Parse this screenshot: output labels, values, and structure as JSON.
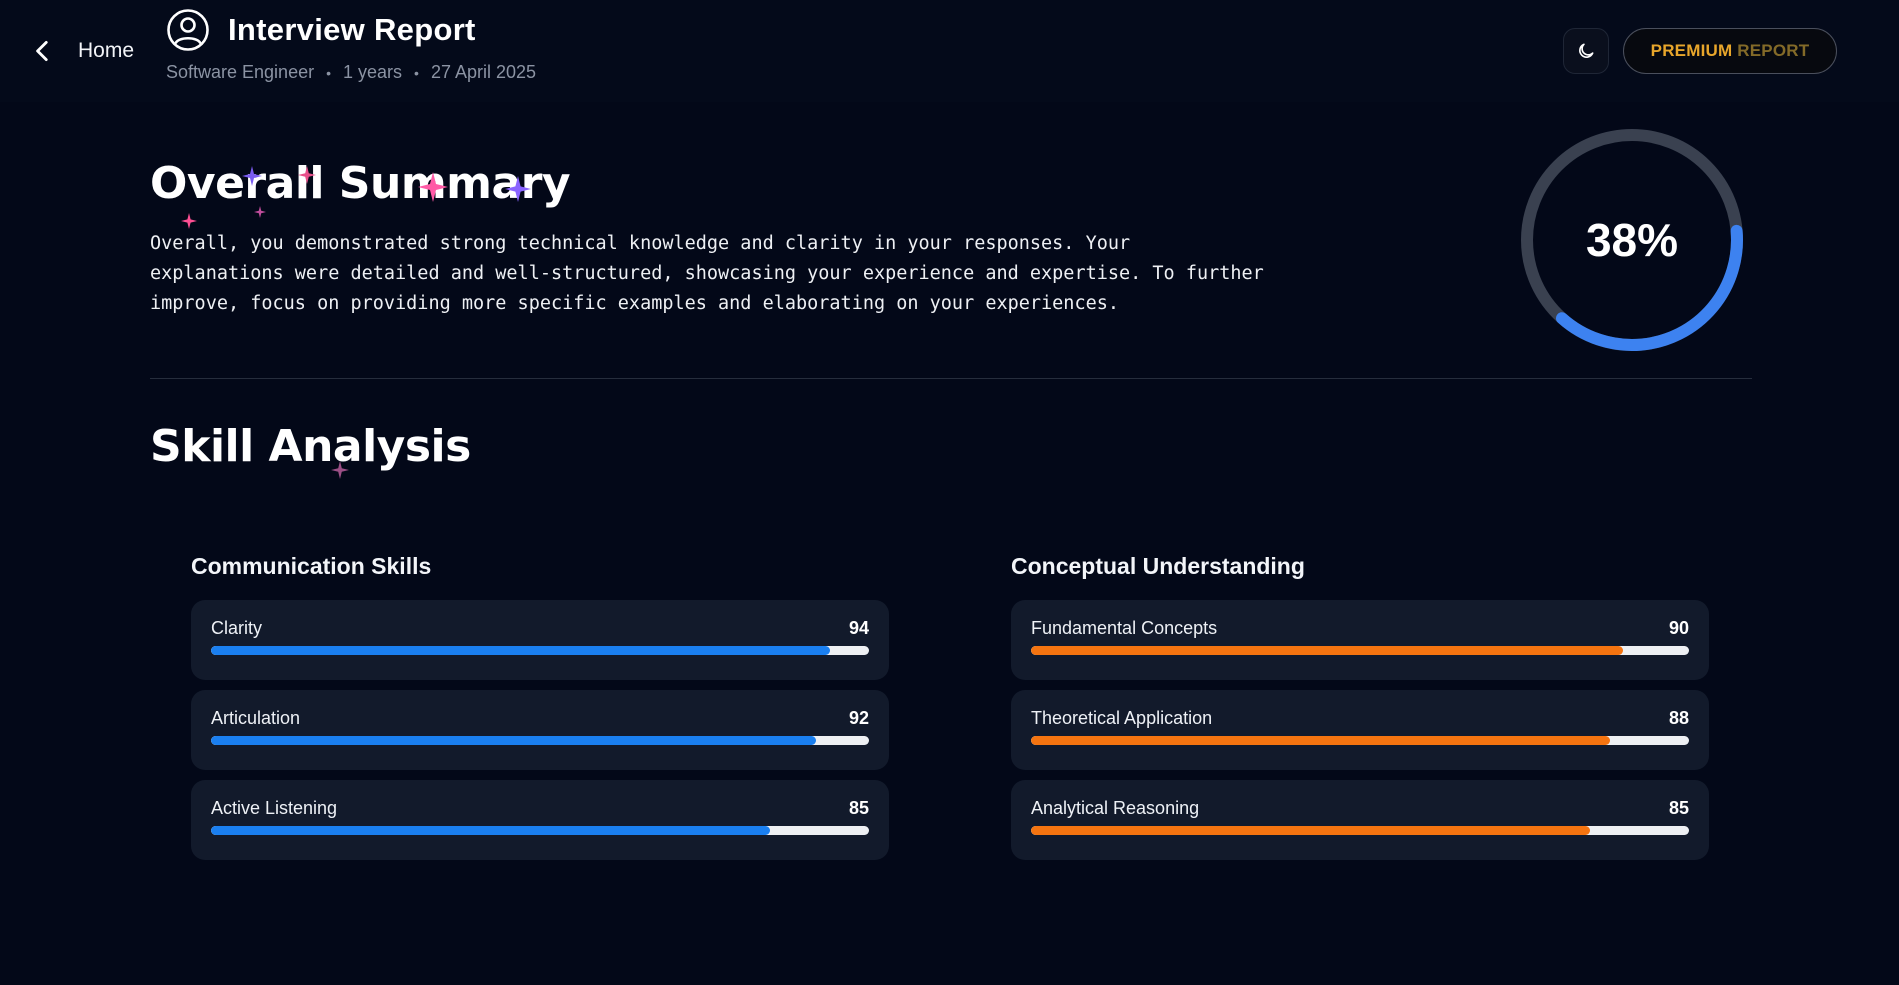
{
  "header": {
    "home_label": "Home",
    "title": "Interview Report",
    "meta": {
      "role": "Software Engineer",
      "experience": "1 years",
      "date": "27 April 2025",
      "separator": "•"
    },
    "premium_label_strong": "PREMIUM",
    "premium_label_dim": "REPORT",
    "icons": {
      "back": "chevron-left-icon",
      "avatar": "user-circle-icon",
      "theme": "moon-icon"
    }
  },
  "summary": {
    "heading": "Overall Summary",
    "text": "Overall, you demonstrated strong technical knowledge and clarity in your responses. Your explanations were detailed and well-structured, showcasing your experience and expertise. To further improve, focus on providing more specific examples and elaborating on your experiences.",
    "score_label": "38%",
    "score_value": 0.38
  },
  "skill_analysis": {
    "heading": "Skill Analysis",
    "groups": [
      {
        "title": "Communication Skills",
        "color": "#1a7ff0",
        "skills": [
          {
            "name": "Clarity",
            "score": "94",
            "value": 94
          },
          {
            "name": "Articulation",
            "score": "92",
            "value": 92
          },
          {
            "name": "Active Listening",
            "score": "85",
            "value": 85
          }
        ]
      },
      {
        "title": "Conceptual Understanding",
        "color": "#f57410",
        "skills": [
          {
            "name": "Fundamental Concepts",
            "score": "90",
            "value": 90
          },
          {
            "name": "Theoretical Application",
            "score": "88",
            "value": 88
          },
          {
            "name": "Analytical Reasoning",
            "score": "85",
            "value": 85
          }
        ]
      }
    ]
  },
  "colors": {
    "background": "#030818",
    "ring_track": "#3a4150",
    "ring_fill": "#3d82f0",
    "premium_gold": "#e8a62b"
  }
}
